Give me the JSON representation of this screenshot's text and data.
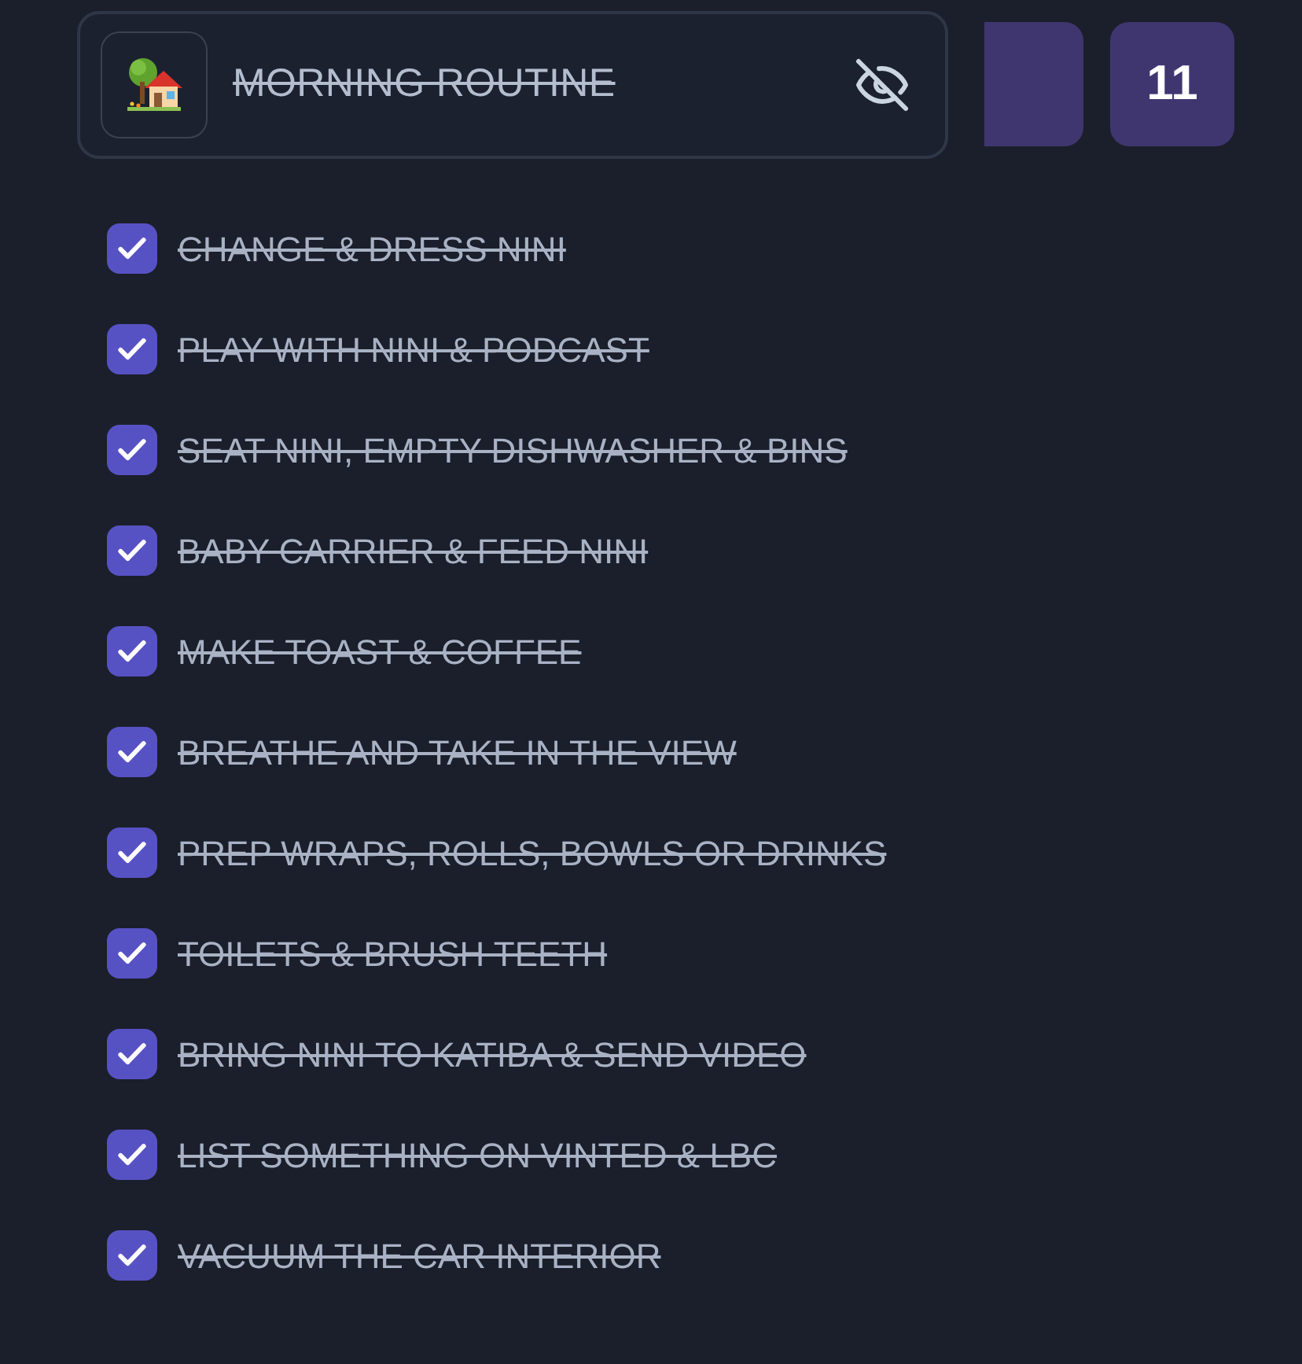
{
  "routine": {
    "title": "MORNING ROUTINE",
    "completed": true
  },
  "tiles": [
    {
      "kind": "blank"
    },
    {
      "kind": "count",
      "label": "11"
    }
  ],
  "tasks": [
    {
      "label": "CHANGE & DRESS NINI",
      "checked": true
    },
    {
      "label": "PLAY WITH NINI & PODCAST",
      "checked": true
    },
    {
      "label": "SEAT NINI, EMPTY DISHWASHER & BINS",
      "checked": true
    },
    {
      "label": "BABY CARRIER & FEED NINI",
      "checked": true
    },
    {
      "label": "MAKE TOAST & COFFEE",
      "checked": true
    },
    {
      "label": "BREATHE AND TAKE IN THE VIEW",
      "checked": true
    },
    {
      "label": "PREP WRAPS, ROLLS, BOWLS OR DRINKS",
      "checked": true
    },
    {
      "label": "TOILETS & BRUSH TEETH",
      "checked": true
    },
    {
      "label": "BRING NINI TO KATIBA & SEND VIDEO",
      "checked": true
    },
    {
      "label": "LIST SOMETHING ON VINTED & LBC",
      "checked": true
    },
    {
      "label": "VACUUM THE CAR INTERIOR",
      "checked": true
    }
  ]
}
